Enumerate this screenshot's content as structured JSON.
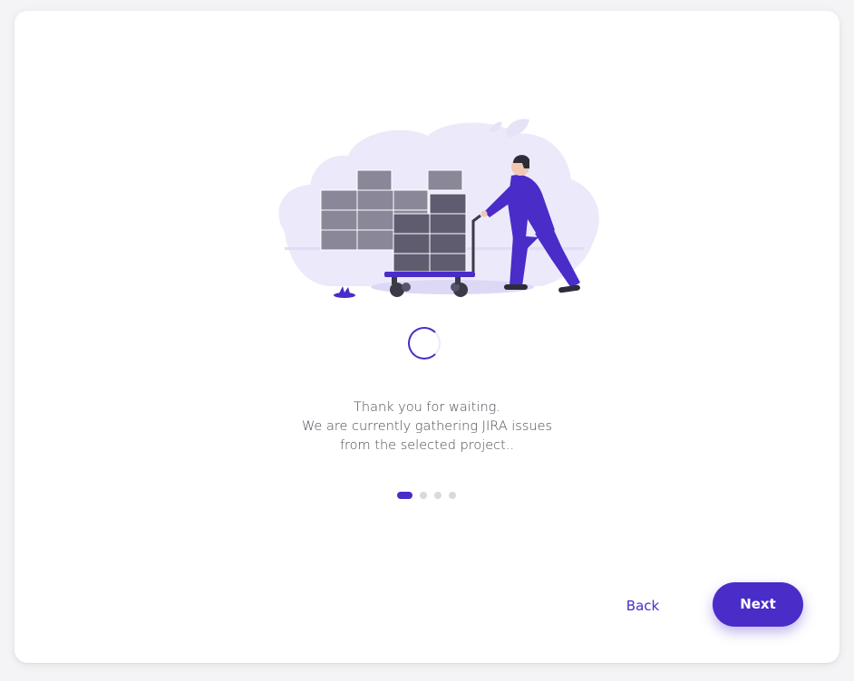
{
  "wizard": {
    "message_lines": [
      "Thank you for waiting.",
      "We are currently gathering JIRA issues",
      "from the selected project.."
    ],
    "steps": {
      "total": 4,
      "current": 1
    },
    "back_label": "Back",
    "next_label": "Next"
  },
  "illustration": {
    "icon": "warehouse-worker-pushing-cart-illustration"
  },
  "colors": {
    "accent": "#4a2cc8",
    "cloud": "#ece9fb",
    "box": "#8a8799",
    "box_dark": "#5f5c70",
    "text": "#4a4a55",
    "dot_inactive": "#d9d9de"
  }
}
